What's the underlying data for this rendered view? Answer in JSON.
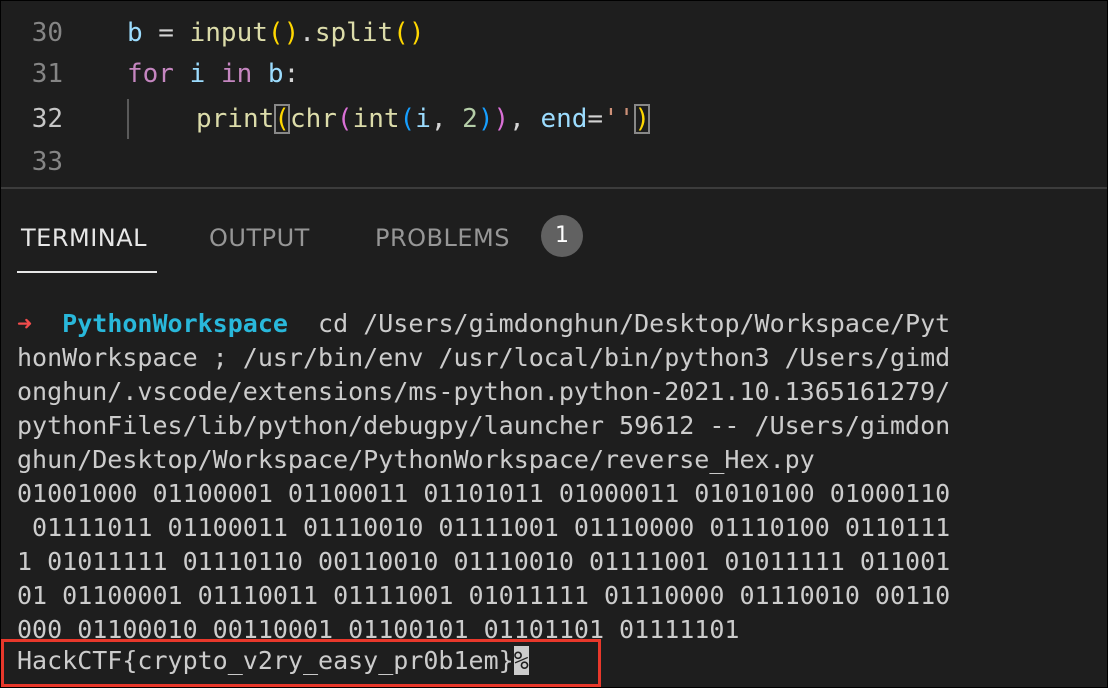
{
  "editor": {
    "lines": [
      {
        "number": "30",
        "tokens": {
          "var_b": "b",
          "eq": " = ",
          "fn_input": "input",
          "lp": "(",
          "rp": ")",
          "dot": ".",
          "fn_split": "split",
          "lp2": "(",
          "rp2": ")"
        }
      },
      {
        "number": "31",
        "tokens": {
          "kw_for": "for",
          "var_i": "i",
          "kw_in": "in",
          "var_b": "b",
          "colon": ":"
        }
      },
      {
        "number": "32",
        "tokens": {
          "fn_print": "print",
          "lp": "(",
          "fn_chr": "chr",
          "lp2": "(",
          "fn_int": "int",
          "lp3": "(",
          "var_i": "i",
          "comma": ", ",
          "num_2": "2",
          "rp3": ")",
          "rp2": ")",
          "comma2": ", ",
          "var_end": "end",
          "eq": "=",
          "str": "''",
          "rp": ")"
        }
      },
      {
        "number": "33"
      }
    ]
  },
  "panel": {
    "tabs": {
      "terminal": "TERMINAL",
      "output": "OUTPUT",
      "problems": "PROBLEMS"
    },
    "problems_count": "1"
  },
  "terminal": {
    "prompt_arrow": "➜",
    "prompt_dir": "PythonWorkspace",
    "lines": [
      "  cd /Users/gimdonghun/Desktop/Workspace/Pyt",
      "honWorkspace ; /usr/bin/env /usr/local/bin/python3 /Users/gimd",
      "onghun/.vscode/extensions/ms-python.python-2021.10.1365161279/",
      "pythonFiles/lib/python/debugpy/launcher 59612 -- /Users/gimdon",
      "ghun/Desktop/Workspace/PythonWorkspace/reverse_Hex.py",
      "01001000 01100001 01100011 01101011 01000011 01010100 01000110",
      " 01111011 01100011 01110010 01111001 01110000 01110100 0110111",
      "1 01011111 01110110 00110010 01110010 01111001 01011111 011001",
      "01 01100001 01110011 01111001 01011111 01110000 01110010 00110",
      "000 01100010 00110001 01100101 01101101 01111101"
    ],
    "flag": "HackCTF{crypto_v2ry_easy_pr0b1em}",
    "cursor": "%"
  },
  "colors": {
    "highlight_box": "#e8382b",
    "prompt_arrow": "#f14c4c",
    "prompt_dir": "#29b8db"
  }
}
